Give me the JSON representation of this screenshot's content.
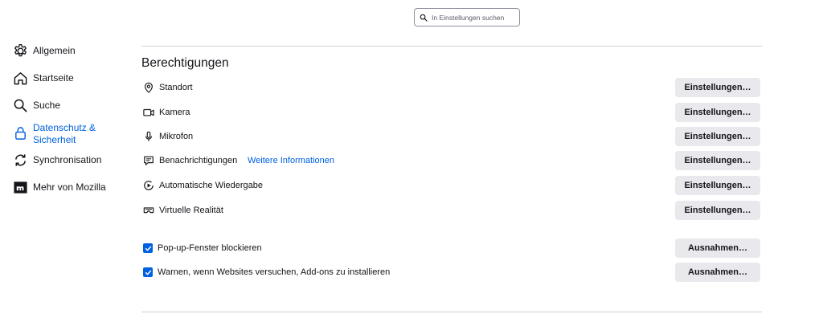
{
  "search": {
    "placeholder": "In Einstellungen suchen"
  },
  "sidebar": {
    "items": [
      {
        "label": "Allgemein",
        "icon": "gear-icon"
      },
      {
        "label": "Startseite",
        "icon": "home-icon"
      },
      {
        "label": "Suche",
        "icon": "search-icon"
      },
      {
        "label": "Datenschutz &\nSicherheit",
        "icon": "lock-icon",
        "active": true
      },
      {
        "label": "Synchronisation",
        "icon": "sync-icon"
      },
      {
        "label": "Mehr von Mozilla",
        "icon": "mozilla-icon"
      }
    ]
  },
  "permissions": {
    "title": "Berechtigungen",
    "rows": [
      {
        "label": "Standort",
        "icon": "location-icon",
        "button": "Einstellungen…"
      },
      {
        "label": "Kamera",
        "icon": "camera-icon",
        "button": "Einstellungen…"
      },
      {
        "label": "Mikrofon",
        "icon": "microphone-icon",
        "button": "Einstellungen…"
      },
      {
        "label": "Benachrichtigungen",
        "icon": "notification-icon",
        "link": "Weitere Informationen",
        "button": "Einstellungen…"
      },
      {
        "label": "Automatische Wiedergabe",
        "icon": "autoplay-icon",
        "button": "Einstellungen…"
      },
      {
        "label": "Virtuelle Realität",
        "icon": "vr-icon",
        "button": "Einstellungen…"
      }
    ],
    "checkboxes": [
      {
        "label": "Pop-up-Fenster blockieren",
        "checked": true,
        "button": "Ausnahmen…"
      },
      {
        "label": "Warnen, wenn Websites versuchen, Add-ons zu installieren",
        "checked": true,
        "button": "Ausnahmen…"
      }
    ]
  },
  "colors": {
    "accent": "#0061e0",
    "button_bg": "#e9e9ed",
    "text": "#15141a",
    "divider": "#cfcfd8"
  }
}
